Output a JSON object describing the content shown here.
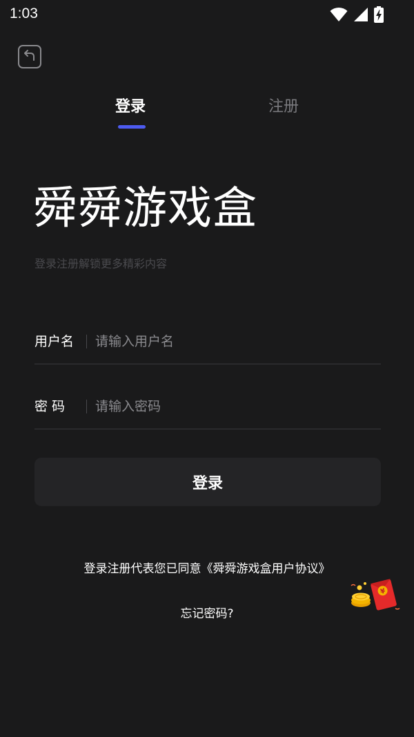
{
  "status_bar": {
    "time": "1:03",
    "icons": [
      "wifi-icon",
      "cell-signal-icon",
      "battery-charging-icon"
    ]
  },
  "header": {
    "back_icon": "back-arrow-icon"
  },
  "tabs": [
    {
      "label": "登录",
      "active": true
    },
    {
      "label": "注册",
      "active": false
    }
  ],
  "app": {
    "title": "舜舜游戏盒",
    "subtitle": "登录注册解锁更多精彩内容"
  },
  "form": {
    "username": {
      "label": "用户名",
      "value": "",
      "placeholder": "请输入用户名"
    },
    "password": {
      "label": "密 码",
      "value": "",
      "placeholder": "请输入密码"
    },
    "submit_label": "登录"
  },
  "footer": {
    "agreement": "登录注册代表您已同意《舜舜游戏盒用户协议》",
    "forgot_password": "忘记密码?"
  },
  "floating": {
    "icon": "red-packet-icon"
  },
  "colors": {
    "background": "#1a1a1b",
    "accent": "#4d5bf0",
    "button_bg": "#242426",
    "muted_text": "#7a7a7e",
    "placeholder": "#8a8a8e",
    "red_packet": "#e52a2a",
    "coin": "#f4b400"
  }
}
